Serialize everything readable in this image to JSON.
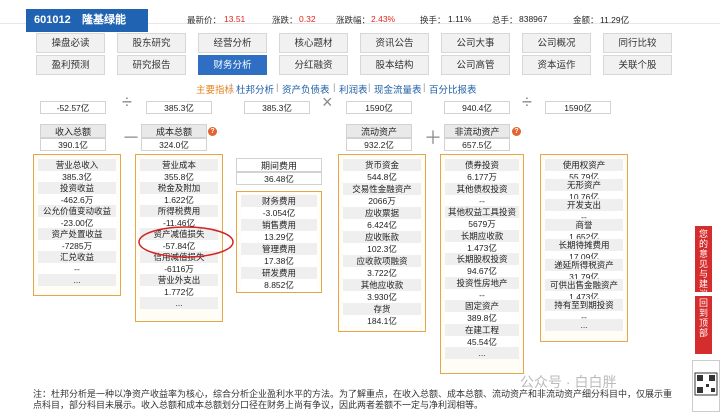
{
  "header": {
    "code": "601012",
    "name": "隆基绿能",
    "latest_label": "最新价：",
    "latest": "13.51",
    "change_label": "涨跌：",
    "change": "0.32",
    "pct_label": "涨跌幅：",
    "pct": "2.43%",
    "turnover_label": "换手：",
    "turnover": "1.11%",
    "volume_label": "总手：",
    "volume": "838967",
    "amount_label": "金额：",
    "amount": "11.29亿"
  },
  "tabs_row1": [
    "操盘必读",
    "股东研究",
    "经营分析",
    "核心题材",
    "资讯公告",
    "公司大事",
    "公司概况",
    "同行比较"
  ],
  "tabs_row2": [
    "盈利预测",
    "研究报告",
    "财务分析",
    "分红融资",
    "股本结构",
    "公司高管",
    "资本运作",
    "关联个股"
  ],
  "subnav": {
    "items": [
      "主要指标",
      "杜邦分析",
      "资产负债表",
      "利润表",
      "现金流量表",
      "百分比报表"
    ],
    "separator": "|"
  },
  "top_partial": {
    "v1": "-52.57亿",
    "v2": "385.3亿",
    "v3": "385.3亿",
    "v4": "1590亿",
    "v5": "940.4亿",
    "v6": "1590亿",
    "div": "÷",
    "mult": "×"
  },
  "level2": {
    "revenue_total": {
      "label": "收入总额",
      "value": "390.1亿"
    },
    "cost_total": {
      "label": "成本总额",
      "value": "324.0亿"
    },
    "current_assets": {
      "label": "流动资产",
      "value": "932.2亿"
    },
    "noncurrent_assets": {
      "label": "非流动资产",
      "value": "657.5亿"
    },
    "minus": "－",
    "plus": "＋",
    "question": "?"
  },
  "col_income": [
    {
      "label": "营业总收入",
      "value": "385.3亿"
    },
    {
      "label": "投资收益",
      "value": "-462.6万"
    },
    {
      "label": "公允价值变动收益",
      "value": "-23.00亿"
    },
    {
      "label": "资产处置收益",
      "value": "-7285万"
    },
    {
      "label": "汇兑收益",
      "value": "--"
    },
    {
      "label": "...",
      "value": ""
    }
  ],
  "col_cost": [
    {
      "label": "营业成本",
      "value": "355.8亿"
    },
    {
      "label": "税金及附加",
      "value": "1.622亿"
    },
    {
      "label": "所得税费用",
      "value": "-11.46亿"
    },
    {
      "label": "资产减值损失",
      "value": "-57.84亿"
    },
    {
      "label": "信用减值损失",
      "value": "-6116万"
    },
    {
      "label": "营业外支出",
      "value": "1.772亿"
    },
    {
      "label": "...",
      "value": ""
    }
  ],
  "period_expense": {
    "label": "期间费用",
    "value": "36.48亿"
  },
  "col_expense": [
    {
      "label": "财务费用",
      "value": "-3.054亿"
    },
    {
      "label": "销售费用",
      "value": "13.29亿"
    },
    {
      "label": "管理费用",
      "value": "17.38亿"
    },
    {
      "label": "研发费用",
      "value": "8.852亿"
    }
  ],
  "col_current": [
    {
      "label": "货币资金",
      "value": "544.8亿"
    },
    {
      "label": "交易性金融资产",
      "value": "2066万"
    },
    {
      "label": "应收票据",
      "value": "6.424亿"
    },
    {
      "label": "应收账款",
      "value": "102.3亿"
    },
    {
      "label": "应收款项融资",
      "value": "3.722亿"
    },
    {
      "label": "其他应收款",
      "value": "3.930亿"
    },
    {
      "label": "存货",
      "value": "184.1亿"
    }
  ],
  "col_noncurrent_left": [
    {
      "label": "债券投资",
      "value": "6.177万"
    },
    {
      "label": "其他债权投资",
      "value": "--"
    },
    {
      "label": "其他权益工具投资",
      "value": "5679万"
    },
    {
      "label": "长期应收款",
      "value": "1.473亿"
    },
    {
      "label": "长期股权投资",
      "value": "94.67亿"
    },
    {
      "label": "投资性房地产",
      "value": "--"
    },
    {
      "label": "固定资产",
      "value": "389.8亿"
    },
    {
      "label": "在建工程",
      "value": "45.54亿"
    },
    {
      "label": "...",
      "value": ""
    }
  ],
  "col_noncurrent_right": [
    {
      "label": "使用权资产",
      "value": "55.79亿"
    },
    {
      "label": "无形资产",
      "value": "10.76亿"
    },
    {
      "label": "开发支出",
      "value": "--"
    },
    {
      "label": "商誉",
      "value": "1.652亿"
    },
    {
      "label": "长期待摊费用",
      "value": "17.09亿"
    },
    {
      "label": "递延所得税资产",
      "value": "31.79亿"
    },
    {
      "label": "可供出售金融资产",
      "value": "1.473亿"
    },
    {
      "label": "持有至到期投资",
      "value": "--"
    },
    {
      "label": "...",
      "value": ""
    }
  ],
  "note": "注：杜邦分析是一种以净资产收益率为核心，综合分析企业盈利水平的方法。为了解重点，在收入总额、成本总额、流动资产和非流动资产细分科目中，仅展示重点科目，部分科目未展示。收入总额和成本总额划分口径在财务上尚有争议，因此两者差额不一定与净利润相等。",
  "sidebar": {
    "feedback": "您的意见与建议",
    "top": "回到顶部"
  },
  "watermark": "公众号 · 白白胖"
}
